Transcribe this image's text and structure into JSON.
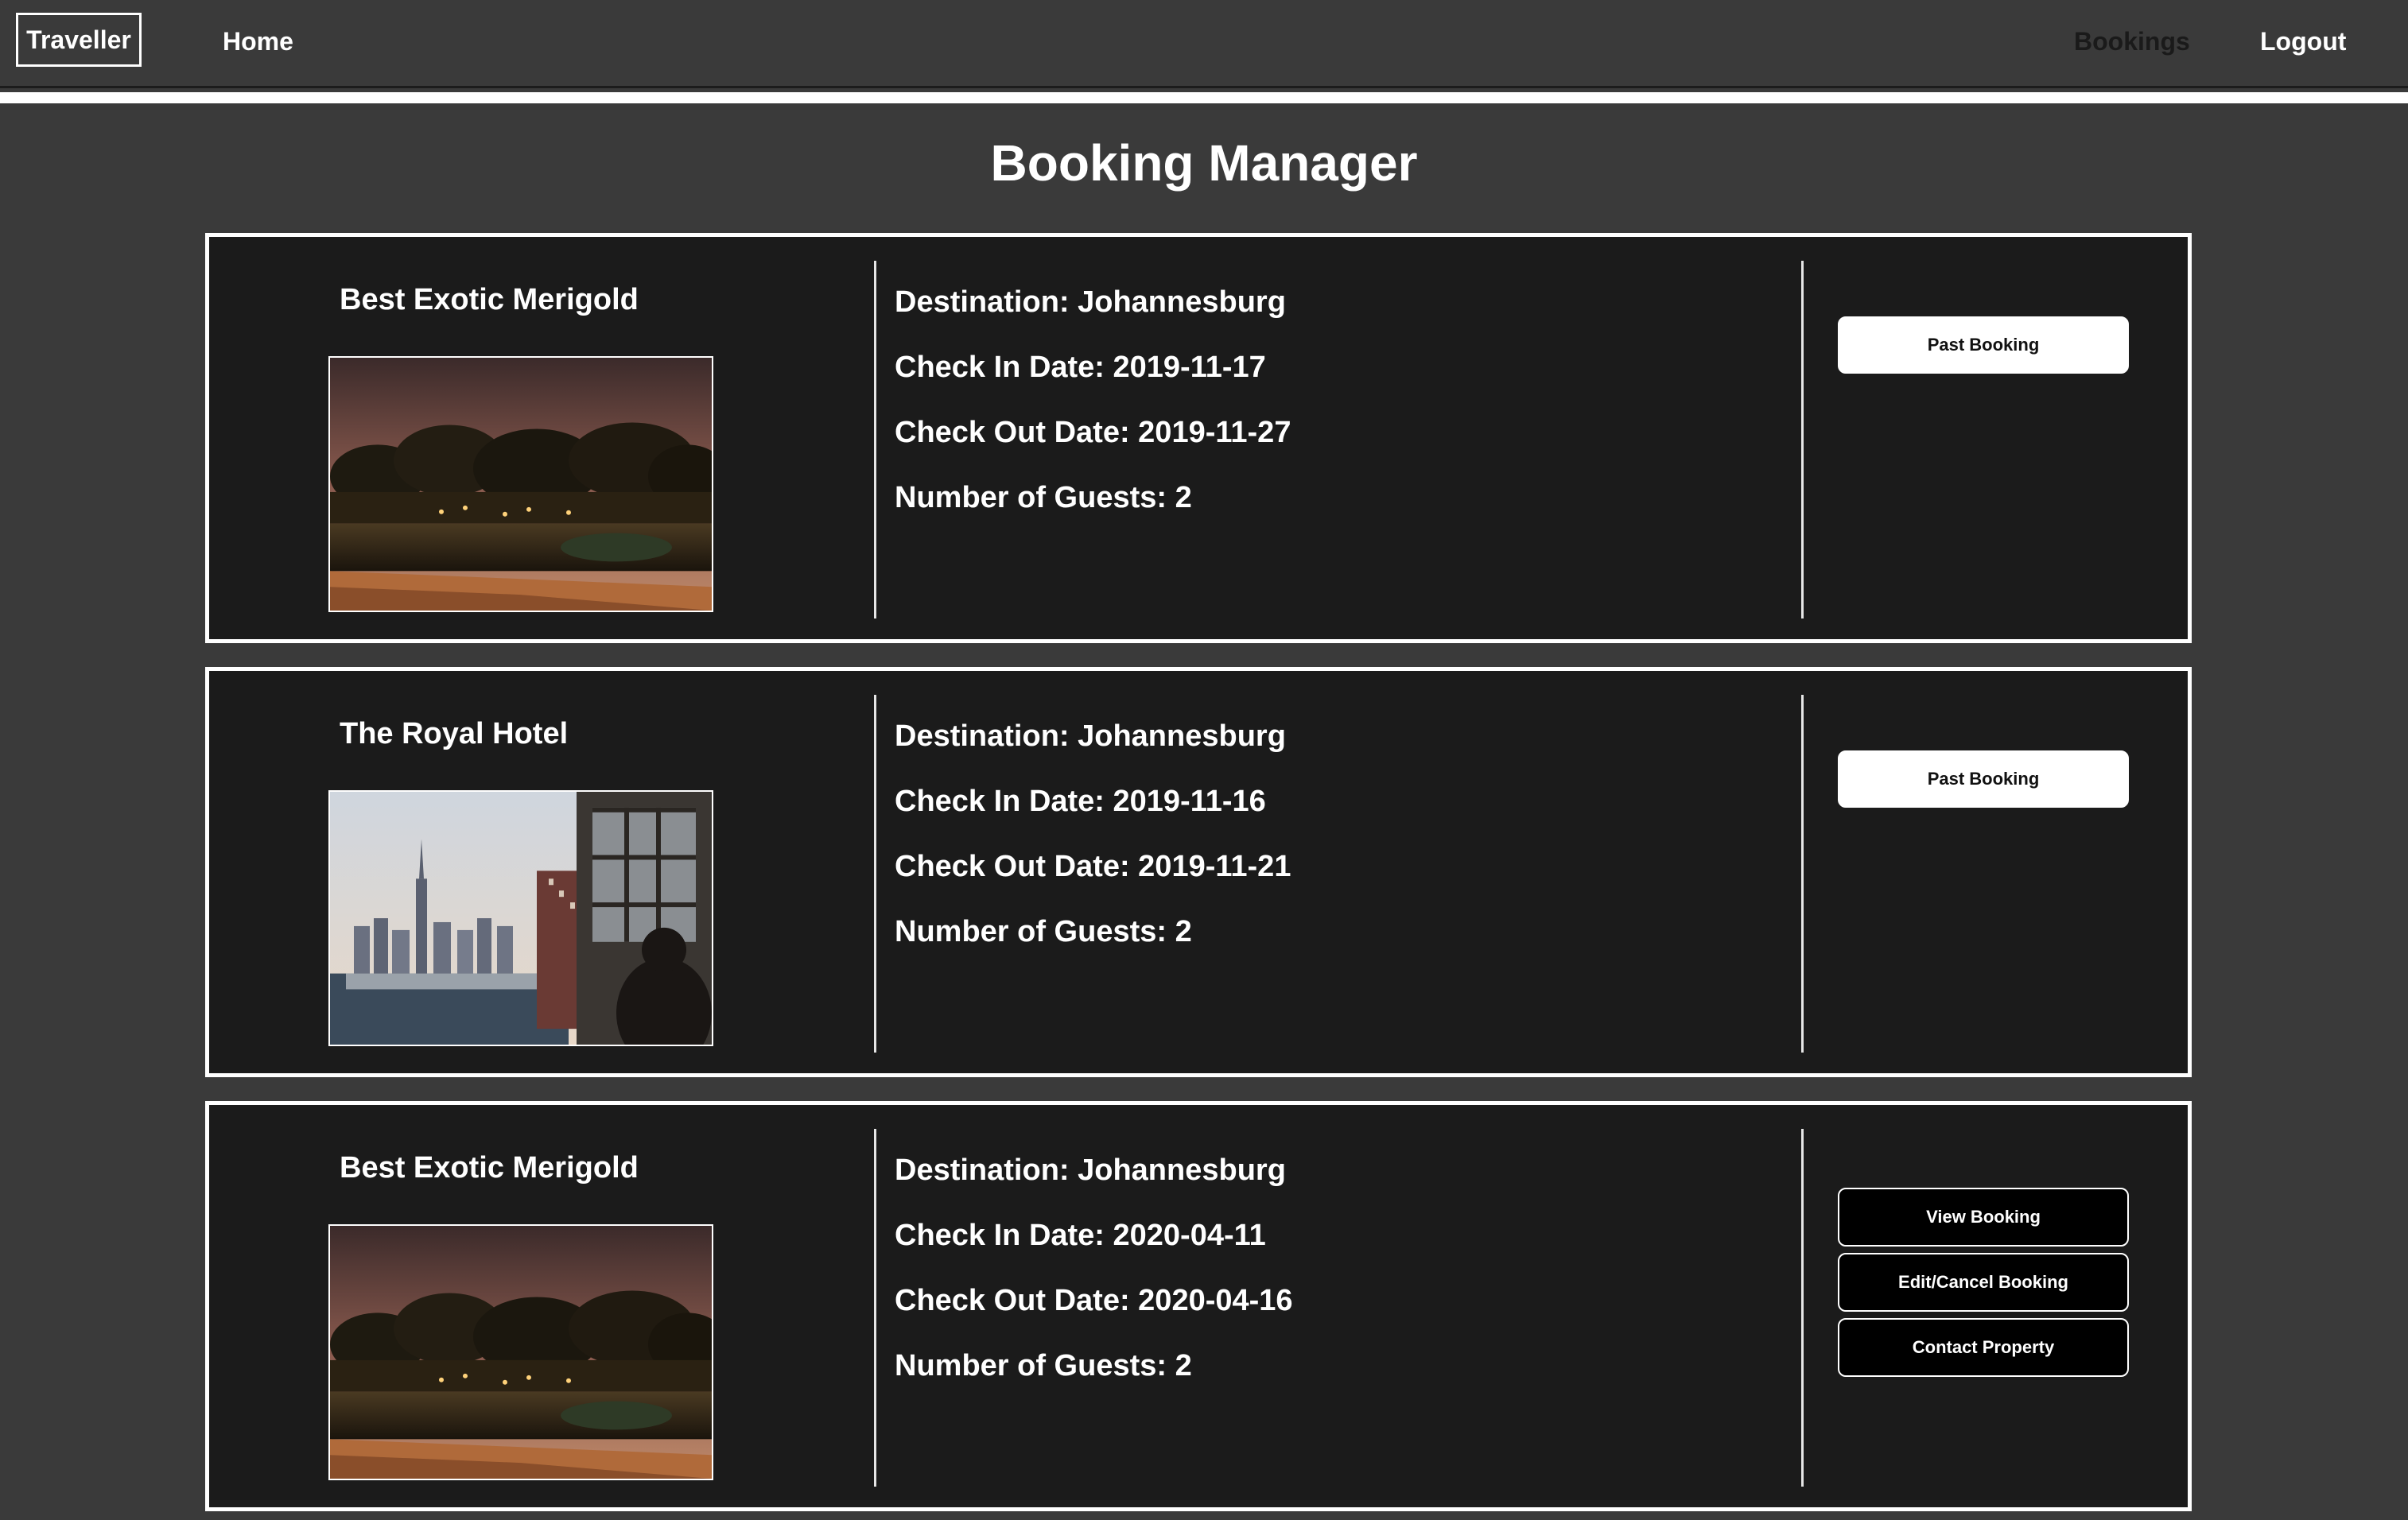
{
  "nav": {
    "brand": "Traveller",
    "home": "Home",
    "bookings": "Bookings",
    "logout": "Logout"
  },
  "page": {
    "title": "Booking Manager"
  },
  "bookings": [
    {
      "hotel": "Best Exotic Merigold",
      "image": "park-at-dusk-photo",
      "destination": "Destination: Johannesburg",
      "check_in": "Check In Date: 2019-11-17",
      "check_out": "Check Out Date: 2019-11-27",
      "guests": "Number of Guests: 2",
      "status_button": "Past Booking"
    },
    {
      "hotel": "The Royal Hotel",
      "image": "city-skyline-hotel-photo",
      "destination": "Destination: Johannesburg",
      "check_in": "Check In Date: 2019-11-16",
      "check_out": "Check Out Date: 2019-11-21",
      "guests": "Number of Guests: 2",
      "status_button": "Past Booking"
    },
    {
      "hotel": "Best Exotic Merigold",
      "image": "park-at-dusk-photo",
      "destination": "Destination: Johannesburg",
      "check_in": "Check In Date: 2020-04-11",
      "check_out": "Check Out Date: 2020-04-16",
      "guests": "Number of Guests: 2",
      "actions": [
        "View Booking",
        "Edit/Cancel Booking",
        "Contact Property"
      ]
    }
  ],
  "colors": {
    "page_bg": "#3a3a3a",
    "card_bg": "#1b1b1b",
    "accent": "#ffffff",
    "active_nav": "#1a1a1a"
  }
}
